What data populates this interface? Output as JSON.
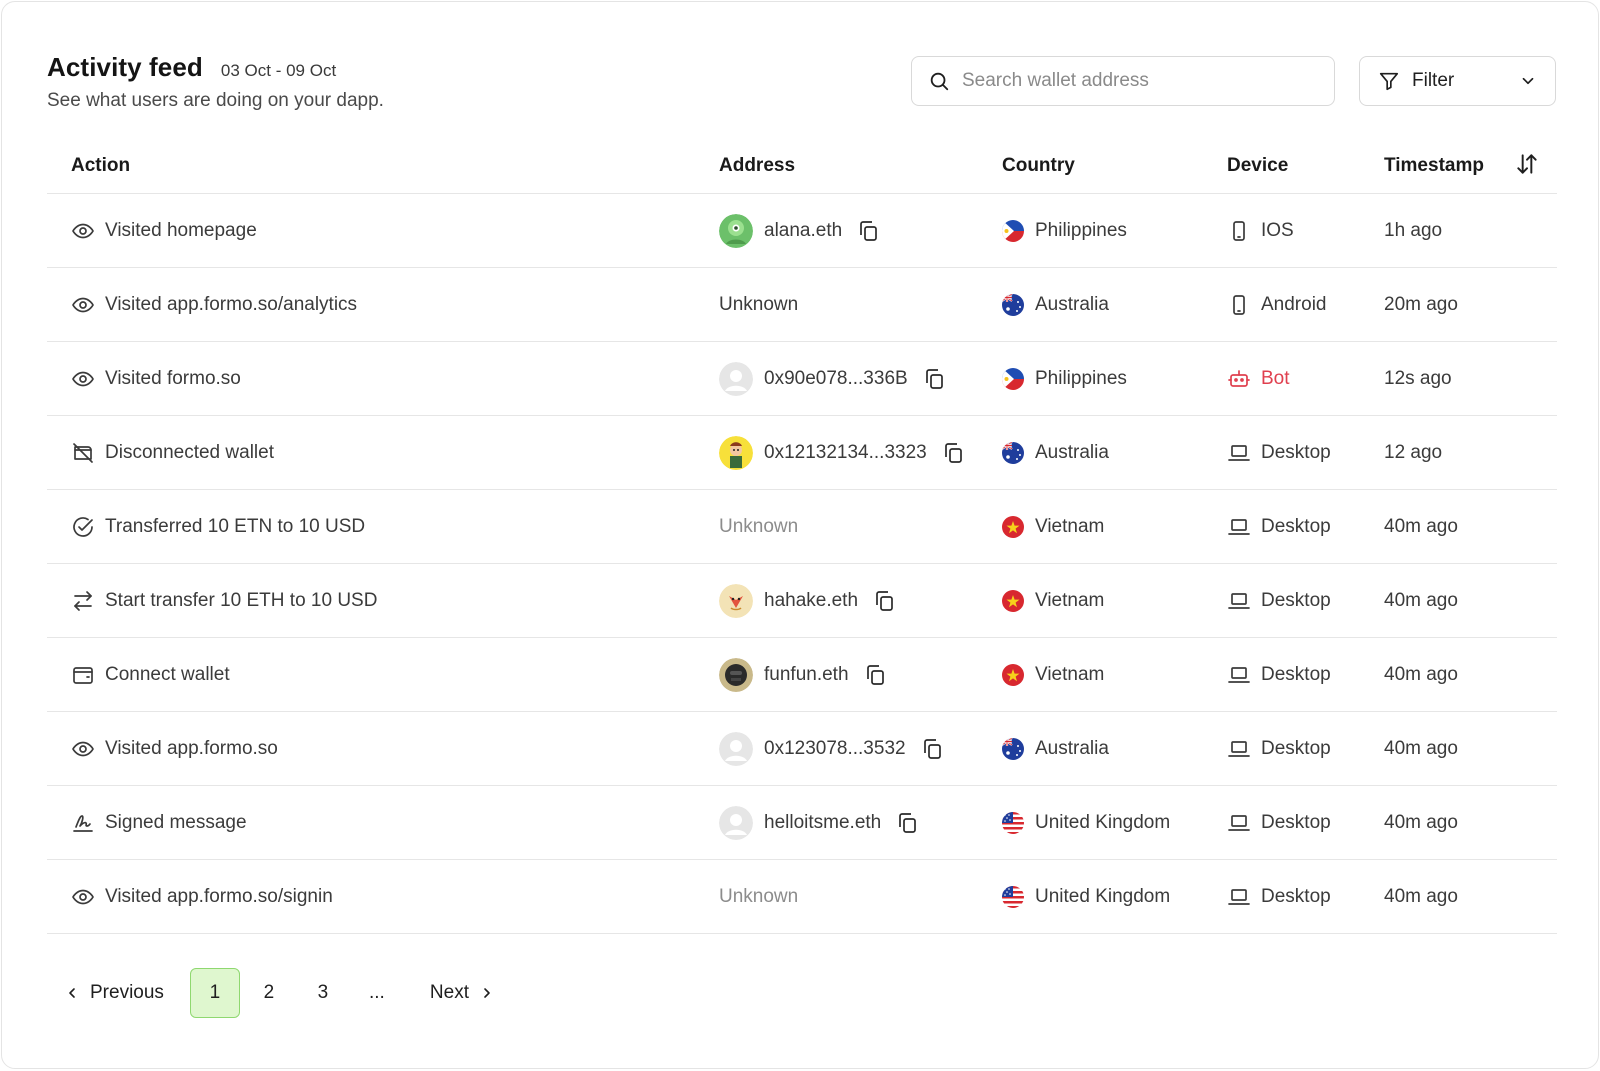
{
  "header": {
    "title": "Activity feed",
    "date_range": "03 Oct - 09 Oct",
    "subtitle": "See what users are doing on your dapp."
  },
  "search": {
    "placeholder": "Search wallet address"
  },
  "filter": {
    "label": "Filter"
  },
  "table": {
    "columns": [
      "Action",
      "Address",
      "Country",
      "Device",
      "Timestamp"
    ],
    "rows": [
      {
        "action_icon": "eye-icon",
        "action": "Visited homepage",
        "avatar": "avatar-green-alien",
        "address": "alana.eth",
        "copyable": true,
        "flag": "philippines",
        "country": "Philippines",
        "device_icon": "mobile-icon",
        "device": "IOS",
        "timestamp": "1h ago"
      },
      {
        "action_icon": "eye-icon",
        "action": "Visited app.formo.so/analytics",
        "avatar": "",
        "address": "Unknown",
        "copyable": false,
        "flag": "australia",
        "country": "Australia",
        "device_icon": "mobile-icon",
        "device": "Android",
        "timestamp": "20m ago"
      },
      {
        "action_icon": "eye-icon",
        "action": "Visited formo.so",
        "avatar": "avatar-default",
        "address": "0x90e078...336B",
        "copyable": true,
        "flag": "philippines",
        "country": "Philippines",
        "device_icon": "bot-icon",
        "device": "Bot",
        "timestamp": "12s ago"
      },
      {
        "action_icon": "wallet-off-icon",
        "action": "Disconnected wallet",
        "avatar": "avatar-yellow-character",
        "address": "0x12132134...3323",
        "copyable": true,
        "flag": "australia",
        "country": "Australia",
        "device_icon": "laptop-icon",
        "device": "Desktop",
        "timestamp": "12 ago"
      },
      {
        "action_icon": "check-circle-icon",
        "action": "Transferred 10 ETN to 10 USD",
        "avatar": "",
        "address": "Unknown",
        "copyable": false,
        "flag": "vietnam",
        "country": "Vietnam",
        "device_icon": "laptop-icon",
        "device": "Desktop",
        "timestamp": "40m ago"
      },
      {
        "action_icon": "swap-arrows-icon",
        "action": "Start transfer 10 ETH to 10 USD",
        "avatar": "avatar-fox",
        "address": "hahake.eth",
        "copyable": true,
        "flag": "vietnam",
        "country": "Vietnam",
        "device_icon": "laptop-icon",
        "device": "Desktop",
        "timestamp": "40m ago"
      },
      {
        "action_icon": "wallet-icon",
        "action": "Connect wallet",
        "avatar": "avatar-dark-character",
        "address": "funfun.eth",
        "copyable": true,
        "flag": "vietnam",
        "country": "Vietnam",
        "device_icon": "laptop-icon",
        "device": "Desktop",
        "timestamp": "40m ago"
      },
      {
        "action_icon": "eye-icon",
        "action": "Visited app.formo.so",
        "avatar": "avatar-default",
        "address": "0x123078...3532",
        "copyable": true,
        "flag": "australia",
        "country": "Australia",
        "device_icon": "laptop-icon",
        "device": "Desktop",
        "timestamp": "40m ago"
      },
      {
        "action_icon": "signature-icon",
        "action": "Signed message",
        "avatar": "avatar-default",
        "address": "helloitsme.eth",
        "copyable": true,
        "flag": "us-stripes",
        "country": "United Kingdom",
        "device_icon": "laptop-icon",
        "device": "Desktop",
        "timestamp": "40m ago"
      },
      {
        "action_icon": "eye-icon",
        "action": "Visited app.formo.so/signin",
        "avatar": "",
        "address": "Unknown",
        "copyable": false,
        "flag": "us-stripes",
        "country": "United Kingdom",
        "device_icon": "laptop-icon",
        "device": "Desktop",
        "timestamp": "40m ago"
      }
    ]
  },
  "pagination": {
    "previous": "Previous",
    "next": "Next",
    "pages": [
      "1",
      "2",
      "3",
      "..."
    ],
    "active": "1"
  },
  "colors": {
    "bot": "#e0404f",
    "active_page_bg": "#dff7cf",
    "active_page_border": "#8fd870",
    "muted": "#8c8c8c"
  }
}
